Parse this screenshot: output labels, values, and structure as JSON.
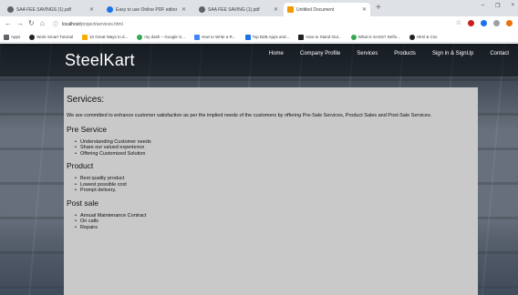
{
  "browser": {
    "tabs": [
      {
        "label": "SAA FEE SAVINGS (1).pdf",
        "active": false,
        "color": "#5f6368"
      },
      {
        "label": "Easy to use Online PDF editor",
        "active": false,
        "color": "#1a73e8"
      },
      {
        "label": "SAA FEE SAVING (1).pdf",
        "active": false,
        "color": "#5f6368"
      },
      {
        "label": "Untitled Document",
        "active": true,
        "color": "#f29900"
      }
    ],
    "new_tab_glyph": "+",
    "window_controls": [
      "–",
      "❐",
      "×"
    ],
    "url_host": "localhost",
    "url_path": "/project/services.html",
    "bookmarks": [
      {
        "label": "Apps",
        "color": "#5f6368"
      },
      {
        "label": "Work Smart Tutorial",
        "color": "#202124"
      },
      {
        "label": "10 Great Ways to d...",
        "color": "#f9ab00"
      },
      {
        "label": "my dash – Google S...",
        "color": "#34a853"
      },
      {
        "label": "How to Write a R...",
        "color": "#4285f4"
      },
      {
        "label": "Top B2B Apps and...",
        "color": "#1a73e8"
      },
      {
        "label": "How to Stand Out...",
        "color": "#202124"
      },
      {
        "label": "What is SASS? Defin...",
        "color": "#34a853"
      },
      {
        "label": "Html & Css",
        "color": "#202124"
      }
    ]
  },
  "site": {
    "logo": "SteelKart",
    "nav": [
      "Home",
      "Company Profile",
      "Services",
      "Products",
      "Sign in & SignUp",
      "Contact"
    ]
  },
  "services": {
    "title": "Services:",
    "intro": "We are committed to enhance customer satisfaction as per the implied needs of the customers by offering Pre-Sale Services, Product Sales and Post-Sale Services.",
    "sections": [
      {
        "heading": "Pre Service",
        "items": [
          "Understanding Customer needs",
          "Share our valued experience",
          "Offering Customized Solution"
        ]
      },
      {
        "heading": "Product",
        "items": [
          "Best quality product",
          "Lowest possible cost",
          "Prompt delivery."
        ]
      },
      {
        "heading": "Post sale",
        "items": [
          "Annual Maintenance Contract",
          "On calls",
          "Repairs"
        ]
      }
    ]
  }
}
